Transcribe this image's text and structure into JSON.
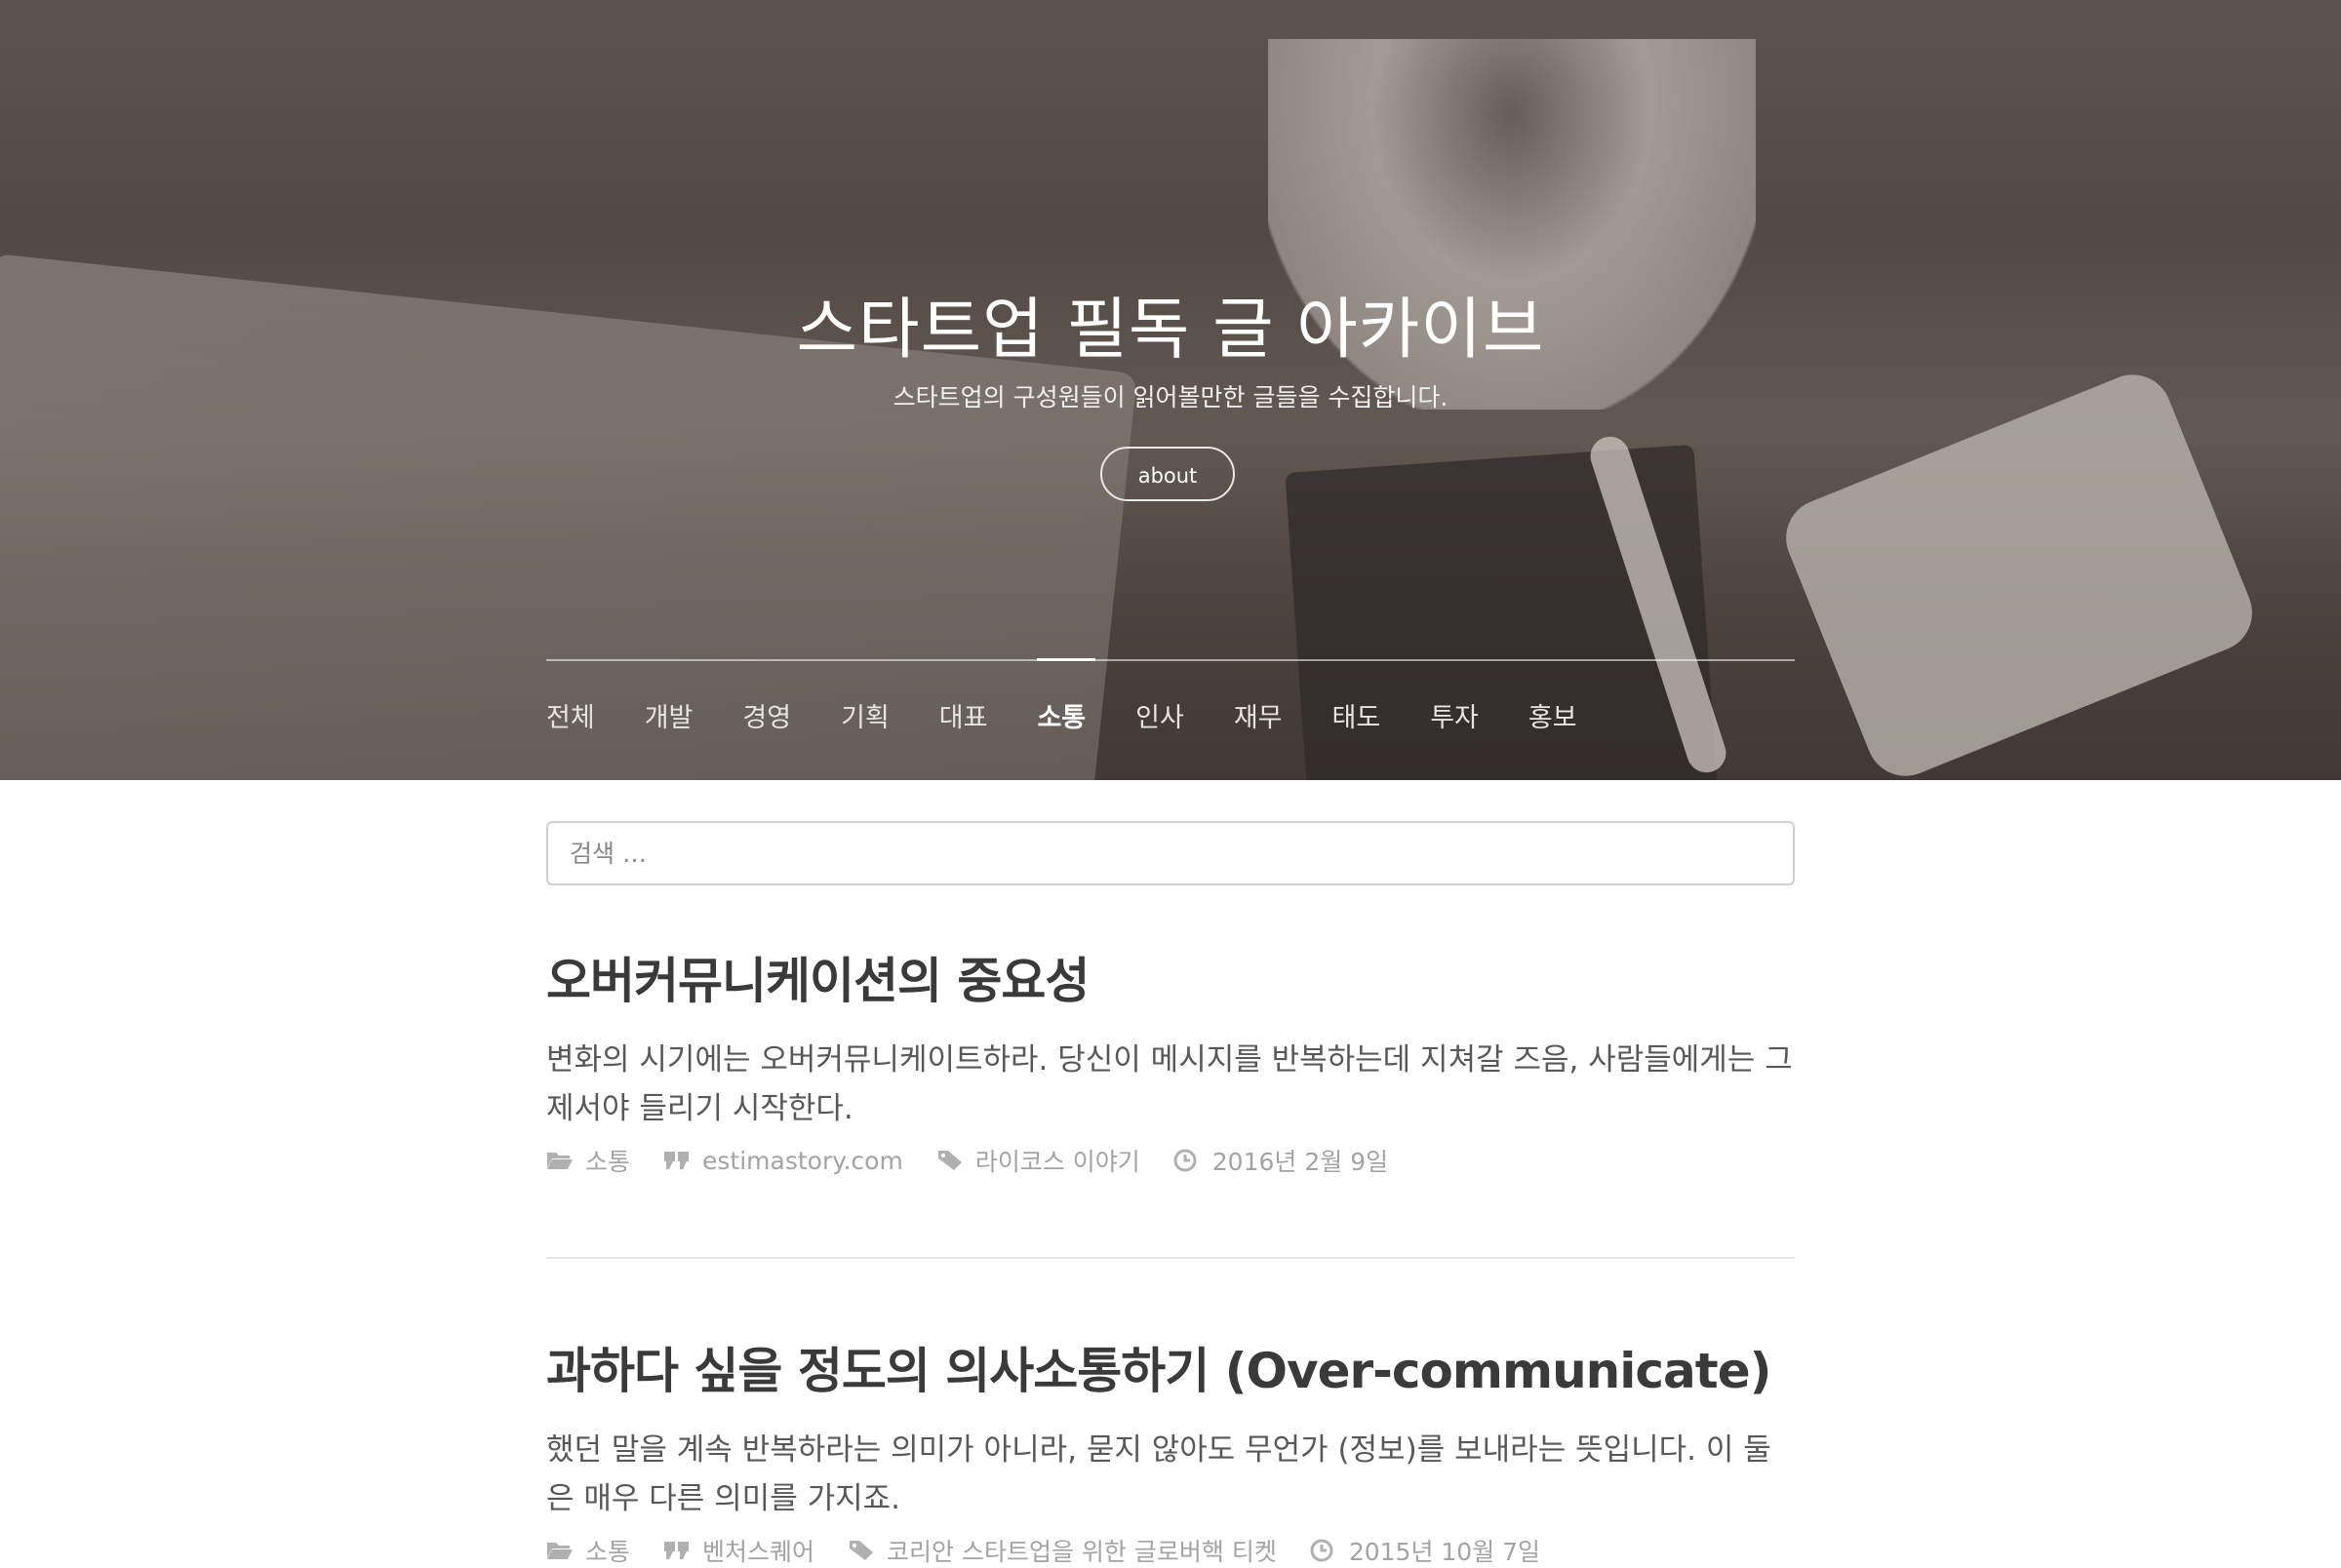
{
  "header": {
    "title": "스타트업 필독 글 아카이브",
    "subtitle": "스타트업의 구성원들이 읽어볼만한 글들을 수집합니다.",
    "about_label": "about"
  },
  "nav": {
    "items": [
      {
        "label": "전체"
      },
      {
        "label": "개발"
      },
      {
        "label": "경영"
      },
      {
        "label": "기획"
      },
      {
        "label": "대표"
      },
      {
        "label": "소통"
      },
      {
        "label": "인사"
      },
      {
        "label": "재무"
      },
      {
        "label": "태도"
      },
      {
        "label": "투자"
      },
      {
        "label": "홍보"
      }
    ],
    "active": "소통"
  },
  "search": {
    "placeholder": "검색 …"
  },
  "posts": [
    {
      "title": "오버커뮤니케이션의 중요성",
      "excerpt": "변화의 시기에는 오버커뮤니케이트하라. 당신이 메시지를 반복하는데 지쳐갈 즈음, 사람들에게는 그제서야 들리기 시작한다.",
      "category": "소통",
      "source": "estimastory.com",
      "tag": "라이코스 이야기",
      "date": "2016년 2월 9일"
    },
    {
      "title": "과하다 싶을 정도의 의사소통하기 (Over-communicate)",
      "excerpt": "했던 말을 계속 반복하라는 의미가 아니라, 묻지 않아도 무언가 (정보)를 보내라는 뜻입니다. 이 둘은 매우 다른 의미를 가지죠.",
      "category": "소통",
      "source": "벤처스퀘어",
      "tag": "코리안 스타트업을 위한 글로버핵 티켓",
      "date": "2015년 10월 7일"
    }
  ],
  "icons": {
    "category": "folder-open-icon",
    "source": "quote-icon",
    "tag": "tag-icon",
    "date": "clock-icon"
  },
  "colors": {
    "title": "#3a3a3a",
    "meta": "#a3a3a3",
    "nav_active": "#ffffff"
  }
}
